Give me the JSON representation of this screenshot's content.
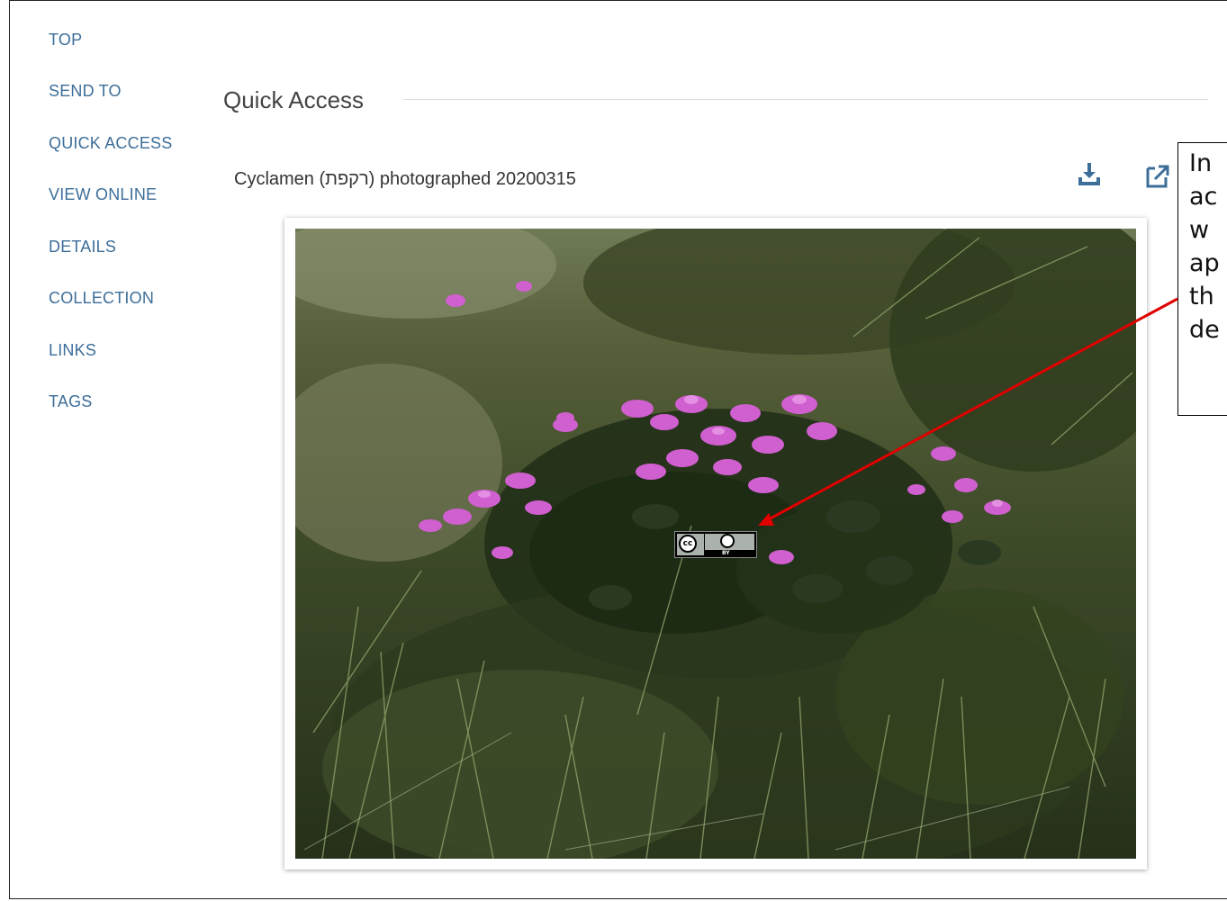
{
  "nav": {
    "items": [
      "TOP",
      "SEND TO",
      "QUICK ACCESS",
      "VIEW ONLINE",
      "DETAILS",
      "COLLECTION",
      "LINKS",
      "TAGS"
    ]
  },
  "section": {
    "title": "Quick Access"
  },
  "item": {
    "title": "Cyclamen (רקפת) photographed 20200315"
  },
  "actions": {
    "download_icon": "download-icon",
    "open_icon": "external-link-icon"
  },
  "license_badge": {
    "left": "cc",
    "right": "BY"
  },
  "callout": {
    "lines": [
      "In",
      "ac",
      "w",
      "ap",
      "th",
      "de"
    ]
  },
  "colors": {
    "nav_link": "#3d6e99",
    "accent": "#3d6e99",
    "arrow": "#e00000"
  }
}
